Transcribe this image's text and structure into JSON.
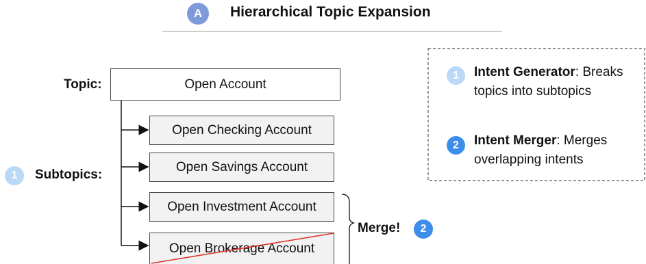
{
  "header": {
    "badge": "A",
    "title": "Hierarchical Topic Expansion"
  },
  "tree": {
    "topic_label": "Topic:",
    "topic": "Open Account",
    "subtopics_label": "Subtopics:",
    "subtopics_badge": "1",
    "subtopics": [
      "Open Checking Account",
      "Open Savings Account",
      "Open Investment Account",
      "Open Brokerage Account"
    ],
    "merge_label": "Merge!",
    "merge_badge": "2"
  },
  "legend": {
    "items": [
      {
        "badge": "1",
        "title": "Intent Generator",
        "desc_line1": ": Breaks",
        "desc_line2": "topics into subtopics"
      },
      {
        "badge": "2",
        "title": "Intent Merger",
        "desc_line1": ": Merges",
        "desc_line2": "overlapping intents"
      }
    ]
  },
  "colors": {
    "badge_light": "#b9d9f7",
    "badge_dark": "#3d8eea",
    "badge_header": "#7f9ad9",
    "subtopic_fill": "#f2f2f2",
    "strike": "#e0342c"
  }
}
